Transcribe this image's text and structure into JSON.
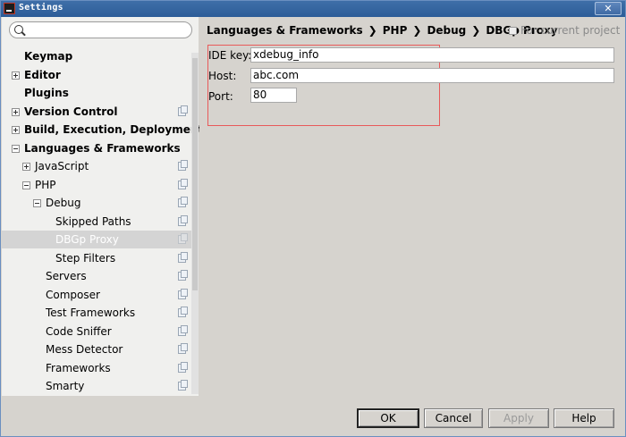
{
  "window": {
    "title": "Settings",
    "close_label": "✕"
  },
  "search": {
    "placeholder": "",
    "value": ""
  },
  "tree": [
    {
      "label": "Keymap"
    },
    {
      "label": "Editor"
    },
    {
      "label": "Plugins"
    },
    {
      "label": "Version Control"
    },
    {
      "label": "Build, Execution, Deployment"
    },
    {
      "label": "Languages & Frameworks"
    },
    {
      "label": "JavaScript"
    },
    {
      "label": "PHP"
    },
    {
      "label": "Debug"
    },
    {
      "label": "Skipped Paths"
    },
    {
      "label": "DBGp Proxy"
    },
    {
      "label": "Step Filters"
    },
    {
      "label": "Servers"
    },
    {
      "label": "Composer"
    },
    {
      "label": "Test Frameworks"
    },
    {
      "label": "Code Sniffer"
    },
    {
      "label": "Mess Detector"
    },
    {
      "label": "Frameworks"
    },
    {
      "label": "Smarty"
    }
  ],
  "breadcrumb": [
    "Languages & Frameworks",
    "PHP",
    "Debug",
    "DBGp Proxy"
  ],
  "breadcrumb_separator": "❯",
  "for_current_project": "For current project",
  "form": {
    "ide_key_label": "IDE key:",
    "ide_key_value": "xdebug_info",
    "host_label": "Host:",
    "host_value": "abc.com",
    "port_label": "Port:",
    "port_value": "80"
  },
  "buttons": {
    "ok": "OK",
    "cancel": "Cancel",
    "apply": "Apply",
    "help": "Help"
  },
  "colors": {
    "highlight_box": "#e85a5a",
    "selected_row": "#d4d4d4",
    "titlebar": "#2c5c98"
  }
}
